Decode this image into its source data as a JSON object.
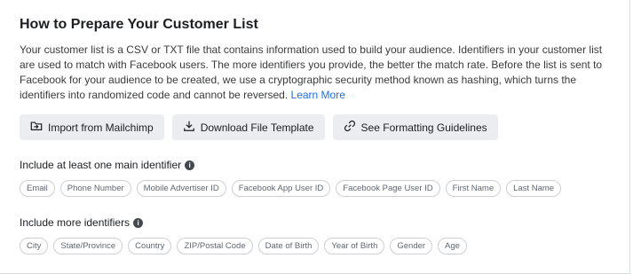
{
  "section": {
    "title": "How to Prepare Your Customer List",
    "description": "Your customer list is a CSV or TXT file that contains information used to build your audience. Identifiers in your customer list are used to match with Facebook users. The more identifiers you provide, the better the match rate. Before the list is sent to Facebook for your audience to be created, we use a cryptographic security method known as hashing, which turns the identifiers into randomized code and cannot be reversed.",
    "learn_more": "Learn More"
  },
  "buttons": {
    "import_label": "Import from Mailchimp",
    "download_label": "Download File Template",
    "guidelines_label": "See Formatting Guidelines"
  },
  "main_identifiers": {
    "label": "Include at least one main identifier",
    "items": [
      "Email",
      "Phone Number",
      "Mobile Advertiser ID",
      "Facebook App User ID",
      "Facebook Page User ID",
      "First Name",
      "Last Name"
    ]
  },
  "more_identifiers": {
    "label": "Include more identifiers",
    "items": [
      "City",
      "State/Province",
      "Country",
      "ZIP/Postal Code",
      "Date of Birth",
      "Year of Birth",
      "Gender",
      "Age"
    ]
  },
  "icons": {
    "import": "folder-import-icon",
    "download": "download-icon",
    "guidelines": "link-icon",
    "info": "info-icon"
  },
  "colors": {
    "link": "#216fdb",
    "button_bg": "#ebedf0",
    "chip_border": "#ccd0d5",
    "chip_text": "#606770"
  }
}
